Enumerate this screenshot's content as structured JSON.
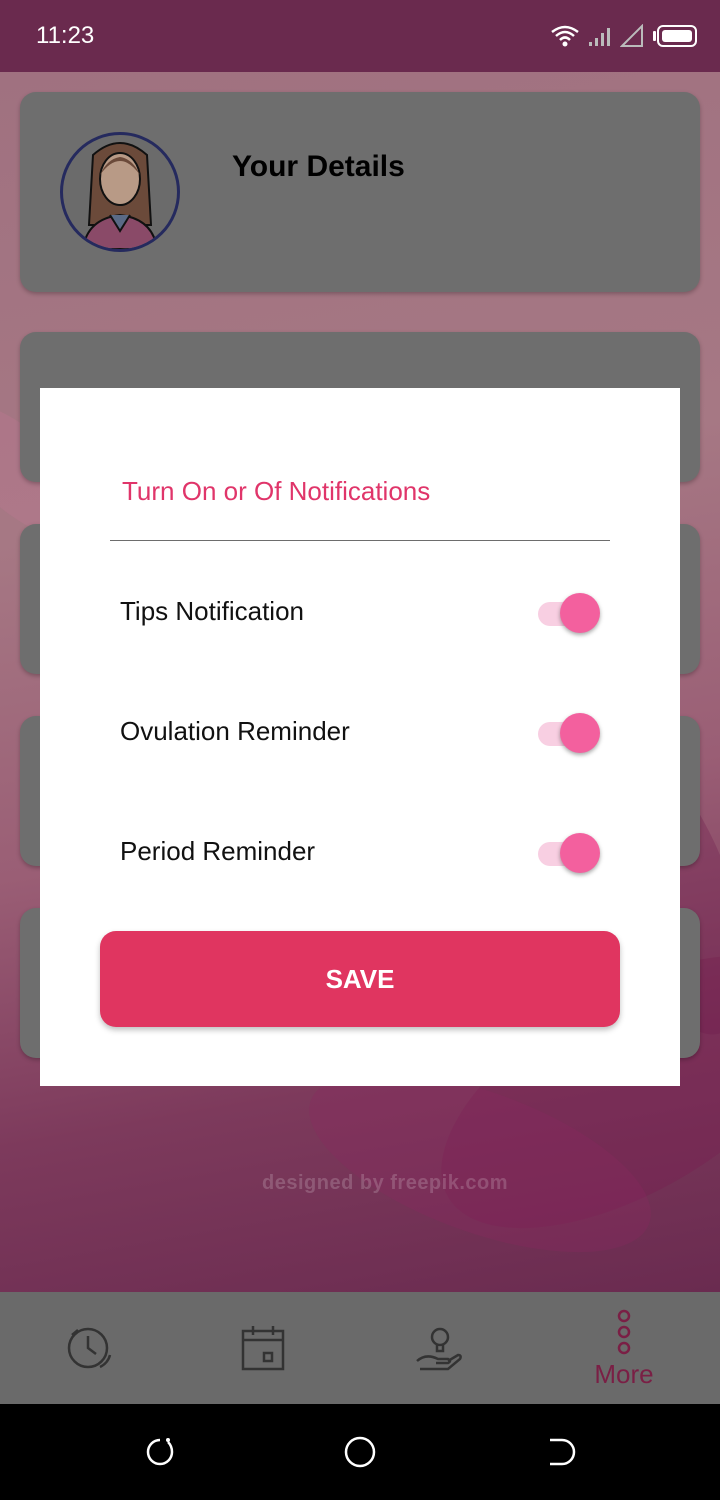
{
  "status_bar": {
    "time": "11:23"
  },
  "profile_card": {
    "title": "Your Details"
  },
  "watermark": {
    "text": "designed by freepik.com"
  },
  "dialog": {
    "title": "Turn On or Of Notifications",
    "toggles": [
      {
        "label": "Tips Notification",
        "on": true
      },
      {
        "label": "Ovulation Reminder",
        "on": true
      },
      {
        "label": "Period Reminder",
        "on": true
      }
    ],
    "save_label": "SAVE"
  },
  "bottom_nav": {
    "items": [
      {
        "icon": "clock-icon"
      },
      {
        "icon": "calendar-icon"
      },
      {
        "icon": "hand-lightbulb-icon"
      },
      {
        "icon": "more-dots-icon",
        "label": "More",
        "active": true
      }
    ]
  },
  "colors": {
    "accent": "#e03560",
    "toggle_thumb": "#f3609e",
    "status_bar": "#6a2a4e",
    "nav_active": "#7a1f45"
  }
}
